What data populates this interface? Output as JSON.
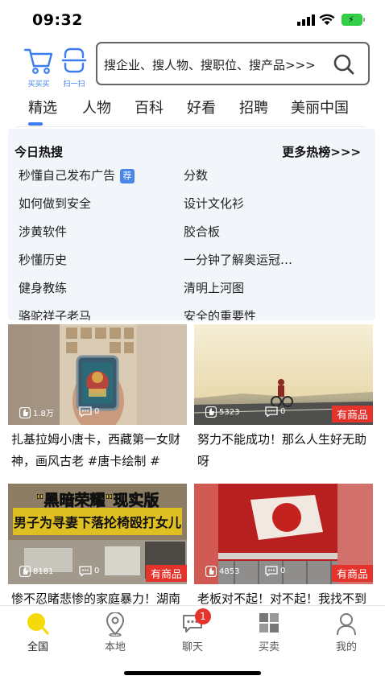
{
  "status": {
    "time": "09:32"
  },
  "header": {
    "cart_label": "买买买",
    "scan_label": "扫一扫",
    "search_placeholder": "搜企业、搜人物、搜职位、搜产品>>>"
  },
  "tabs": [
    {
      "label": "精选",
      "active": true
    },
    {
      "label": "人物"
    },
    {
      "label": "百科"
    },
    {
      "label": "好看"
    },
    {
      "label": "招聘"
    },
    {
      "label": "美丽中国"
    }
  ],
  "hot": {
    "title": "今日热搜",
    "more": "更多热榜>>>",
    "recommend_badge": "荐",
    "items": [
      {
        "text": "秒懂自己发布广告"
      },
      {
        "text": "分数"
      },
      {
        "text": "如何做到安全"
      },
      {
        "text": "设计文化衫"
      },
      {
        "text": "涉黄软件"
      },
      {
        "text": "胶合板"
      },
      {
        "text": "秒懂历史"
      },
      {
        "text": "一分钟了解奥运冠…"
      },
      {
        "text": "健身教练"
      },
      {
        "text": "清明上河图"
      },
      {
        "text": "骆驼祥子老马"
      },
      {
        "text": "安全的重要性"
      }
    ]
  },
  "cards": [
    {
      "likes": "1.8万",
      "comments": "0",
      "goods": "",
      "caption": "扎基拉姆小唐卡，西藏第一女财神，画风古老 #唐卡绘制 #支…"
    },
    {
      "likes": "5323",
      "comments": "0",
      "goods": "有商品",
      "caption": "努力不能成功！那么人生好无助呀"
    },
    {
      "likes": "8181",
      "comments": "0",
      "goods": "有商品",
      "overlay_line1": "\"黑暗荣耀\"现实版",
      "overlay_line2": "男子为寻妻下落抡椅殴打女儿",
      "caption": "惨不忍睹悲惨的家庭暴力！湖南"
    },
    {
      "likes": "4853",
      "comments": "0",
      "goods": "有商品",
      "caption": "老板对不起！对不起！我找不到"
    }
  ],
  "nav": [
    {
      "label": "全国",
      "icon": "home-circle-icon"
    },
    {
      "label": "本地",
      "icon": "location-pin-icon"
    },
    {
      "label": "聊天",
      "icon": "chat-bubble-icon",
      "badge": "1"
    },
    {
      "label": "买卖",
      "icon": "grid-icon"
    },
    {
      "label": "我的",
      "icon": "person-icon"
    }
  ],
  "colors": {
    "accent": "#3b7df0",
    "badge_red": "#e5332c",
    "home_yellow": "#f5d90a"
  }
}
